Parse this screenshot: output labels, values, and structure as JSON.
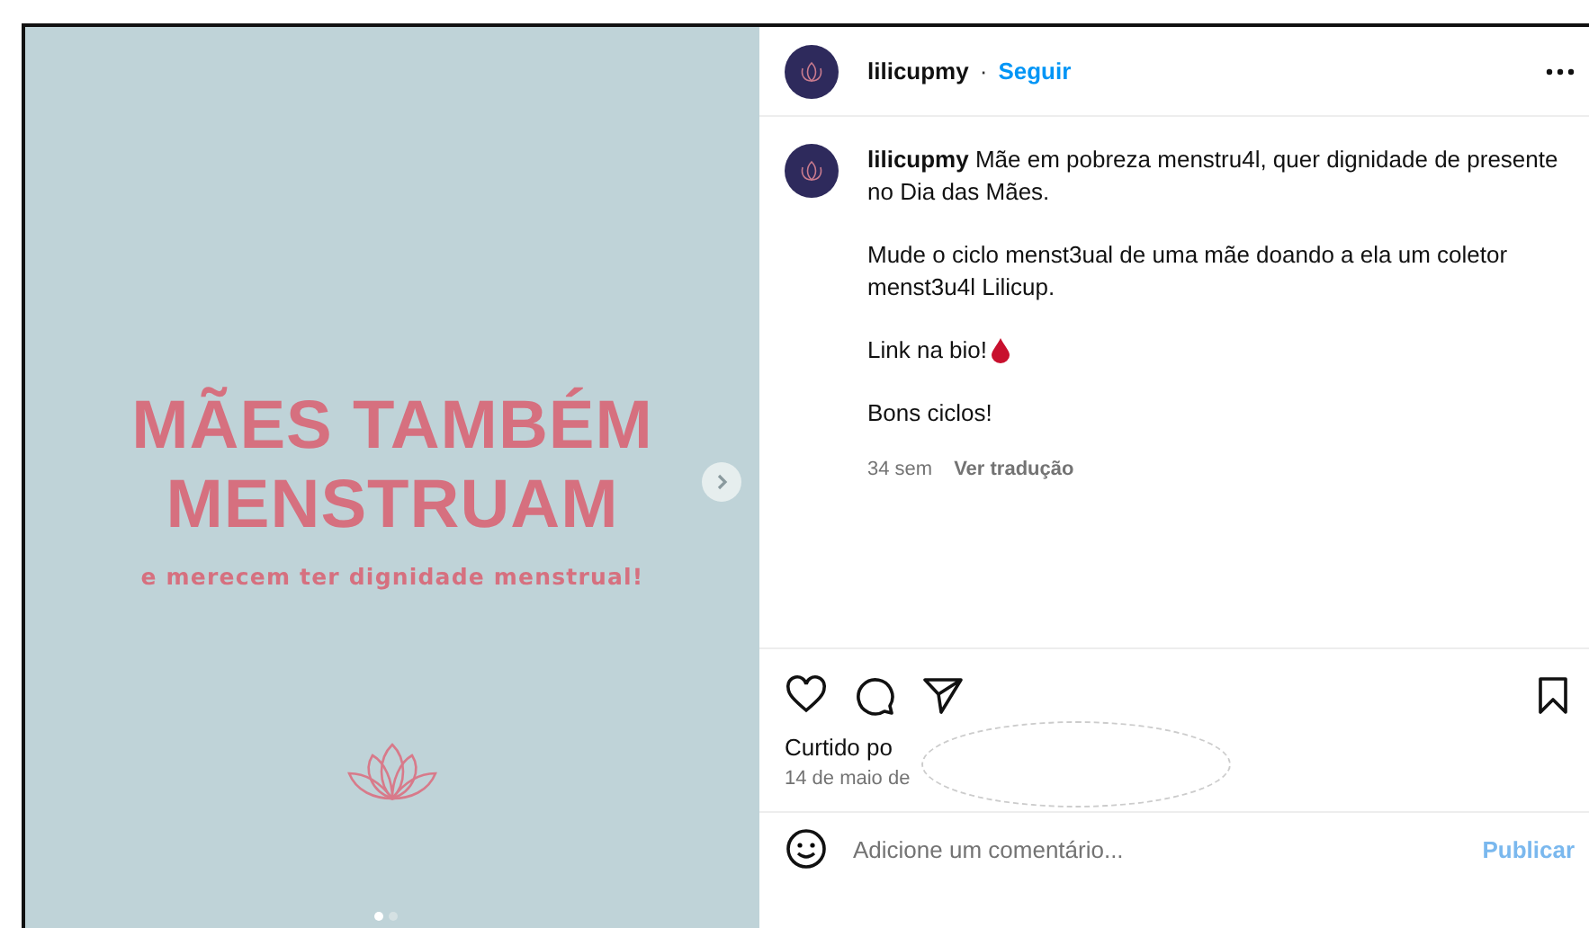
{
  "post_image": {
    "headline": [
      "MÃES TAMBÉM",
      "MENSTRUAM"
    ],
    "subtitle": "e merecem ter dignidade menstrual!",
    "dots": [
      {
        "selected": true
      },
      {
        "selected": false
      }
    ]
  },
  "header": {
    "username": "lilicupmy",
    "separator": "·",
    "follow": "Seguir"
  },
  "caption": {
    "username": "lilicupmy",
    "paragraphs": [
      "Mãe em pobreza menstru4l, quer dignidade de presente no Dia das Mães.",
      "Mude o ciclo menst3ual de uma mãe doando a ela um coletor menst3u4l Lilicup.",
      "Link na bio!",
      "Bons ciclos!"
    ],
    "age": "34 sem",
    "translate": "Ver tradução"
  },
  "likes": {
    "liked_by": "Curtido po",
    "date": "14 de maio de"
  },
  "comment": {
    "placeholder": "Adicione um comentário...",
    "publish": "Publicar",
    "publish_disabled": true
  }
}
